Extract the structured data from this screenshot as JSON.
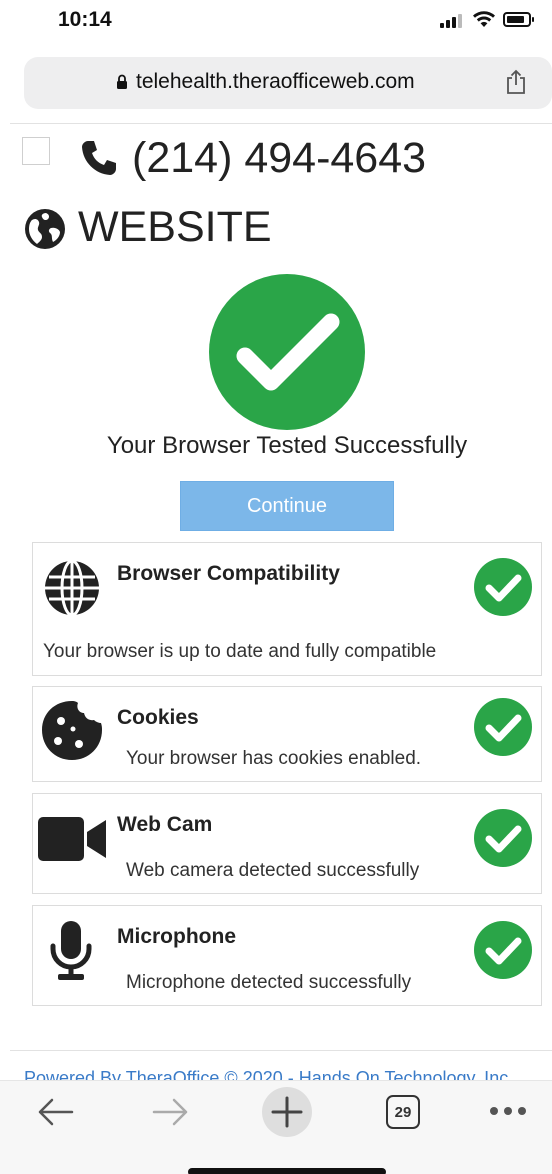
{
  "status_bar": {
    "time": "10:14"
  },
  "browser": {
    "url": "telehealth.theraofficeweb.com"
  },
  "contact": {
    "phone": "(214) 494-4643",
    "website": "WEBSITE"
  },
  "result": {
    "title": "Your Browser Tested Successfully",
    "continue_label": "Continue"
  },
  "checks": [
    {
      "title": "Browser Compatibility",
      "description": "Your browser is up to date and fully compatible",
      "icon": "globe-icon"
    },
    {
      "title": "Cookies",
      "description": "Your browser has cookies enabled.",
      "icon": "cookie-icon"
    },
    {
      "title": "Web Cam",
      "description": "Web camera detected successfully",
      "icon": "video-camera-icon"
    },
    {
      "title": "Microphone",
      "description": "Microphone detected successfully",
      "icon": "microphone-icon"
    }
  ],
  "footer": {
    "text": "Powered By TheraOffice © 2020 - Hands On Technology, Inc."
  },
  "toolbar": {
    "tab_count": "29"
  },
  "colors": {
    "success_green": "#2aa548",
    "button_blue": "#7cb7e9",
    "link_blue": "#3a7bc8"
  }
}
